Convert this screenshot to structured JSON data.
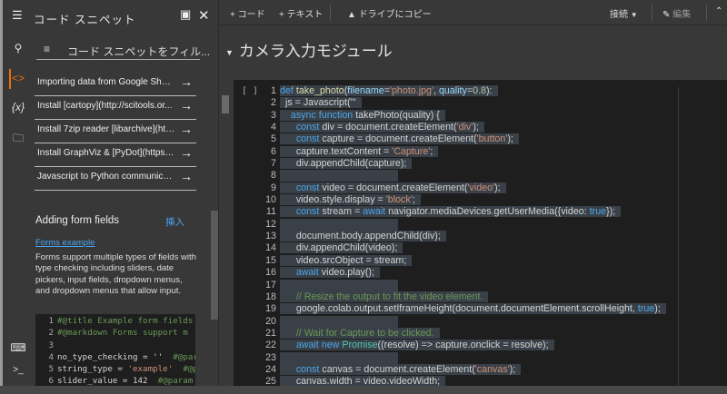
{
  "sidebar_rail": {
    "icons": [
      "menu-icon",
      "search-icon",
      "code-icon",
      "variables-icon",
      "folder-icon",
      "command-palette-icon",
      "terminal-icon"
    ],
    "variables_glyph": "{x}"
  },
  "panel": {
    "title": "コード スニペット",
    "filter_placeholder": "コード スニペットをフィル...",
    "items": [
      "Importing data from Google Sheets",
      "Install [cartopy](http://scitools.or...",
      "Install 7zip reader [libarchive](htt...",
      "Install GraphViz & [PyDot](https://...",
      "Javascript to Python communicat..."
    ],
    "section": {
      "title": "Adding form fields",
      "insert_label": "挿入",
      "link": "Forms example",
      "description": "Forms support multiple types of fields with type checking including sliders, date pickers, input fields, dropdown menus, and dropdown menus that allow input.",
      "code": [
        [
          [
            "cm",
            "#@title Example form fields"
          ]
        ],
        [
          [
            "cm",
            "#@markdown Forms support m"
          ]
        ],
        [],
        [
          [
            "p",
            "no_type_checking = ''  "
          ],
          [
            "cm",
            "#@para"
          ]
        ],
        [
          [
            "p",
            "string_type = "
          ],
          [
            "str",
            "'example'"
          ],
          [
            "p",
            "  "
          ],
          [
            "cm",
            "#@pa"
          ]
        ],
        [
          [
            "p",
            "slider_value = 142  "
          ],
          [
            "cm",
            "#@param"
          ]
        ]
      ]
    }
  },
  "toolbar": {
    "add_code": "+ コード",
    "add_text": "+ テキスト",
    "copy_drive": "ドライブにコピー",
    "connect": "接続",
    "edit": "編集"
  },
  "notebook": {
    "heading": "カメラ入力モジュール",
    "run_indicator": "[ ]",
    "code": [
      [
        [
          "kw",
          "def"
        ],
        [
          "p",
          " "
        ],
        [
          "fn",
          "take_photo"
        ],
        [
          "p",
          "("
        ],
        [
          "param",
          "filename"
        ],
        [
          "p",
          "="
        ],
        [
          "str",
          "'photo.jpg'"
        ],
        [
          "p",
          ", "
        ],
        [
          "param",
          "quality"
        ],
        [
          "p",
          "="
        ],
        [
          "num",
          "0.8"
        ],
        [
          "p",
          "):"
        ]
      ],
      [
        [
          "p",
          "  js = Javascript('''"
        ]
      ],
      [
        [
          "p",
          "    "
        ],
        [
          "kw",
          "async function"
        ],
        [
          "p",
          " takePhoto(quality) {"
        ]
      ],
      [
        [
          "p",
          "      "
        ],
        [
          "kw",
          "const"
        ],
        [
          "p",
          " div = document.createElement("
        ],
        [
          "str",
          "'div'"
        ],
        [
          "p",
          ");"
        ]
      ],
      [
        [
          "p",
          "      "
        ],
        [
          "kw",
          "const"
        ],
        [
          "p",
          " capture = document.createElement("
        ],
        [
          "str",
          "'button'"
        ],
        [
          "p",
          ");"
        ]
      ],
      [
        [
          "p",
          "      capture.textContent = "
        ],
        [
          "str",
          "'Capture'"
        ],
        [
          "p",
          ";"
        ]
      ],
      [
        [
          "p",
          "      div.appendChild(capture);"
        ]
      ],
      [],
      [
        [
          "p",
          "      "
        ],
        [
          "kw",
          "const"
        ],
        [
          "p",
          " video = document.createElement("
        ],
        [
          "str",
          "'video'"
        ],
        [
          "p",
          ");"
        ]
      ],
      [
        [
          "p",
          "      video.style.display = "
        ],
        [
          "str",
          "'block'"
        ],
        [
          "p",
          ";"
        ]
      ],
      [
        [
          "p",
          "      "
        ],
        [
          "kw",
          "const"
        ],
        [
          "p",
          " stream = "
        ],
        [
          "kw",
          "await"
        ],
        [
          "p",
          " navigator.mediaDevices.getUserMedia({video: "
        ],
        [
          "kw",
          "true"
        ],
        [
          "p",
          "});"
        ]
      ],
      [],
      [
        [
          "p",
          "      document.body.appendChild(div);"
        ]
      ],
      [
        [
          "p",
          "      div.appendChild(video);"
        ]
      ],
      [
        [
          "p",
          "      video.srcObject = stream;"
        ]
      ],
      [
        [
          "p",
          "      "
        ],
        [
          "kw",
          "await"
        ],
        [
          "p",
          " video.play();"
        ]
      ],
      [],
      [
        [
          "p",
          "      "
        ],
        [
          "cm",
          "// Resize the output to fit the video element."
        ]
      ],
      [
        [
          "p",
          "      google.colab.output.setIframeHeight(document.documentElement.scrollHeight, "
        ],
        [
          "kw",
          "true"
        ],
        [
          "p",
          ");"
        ]
      ],
      [],
      [
        [
          "p",
          "      "
        ],
        [
          "cm",
          "// Wait for Capture to be clicked."
        ]
      ],
      [
        [
          "p",
          "      "
        ],
        [
          "kw",
          "await new"
        ],
        [
          "p",
          " "
        ],
        [
          "cls",
          "Promise"
        ],
        [
          "p",
          "((resolve) => capture.onclick = resolve);"
        ]
      ],
      [],
      [
        [
          "p",
          "      "
        ],
        [
          "kw",
          "const"
        ],
        [
          "p",
          " canvas = document.createElement("
        ],
        [
          "str",
          "'canvas'"
        ],
        [
          "p",
          ");"
        ]
      ],
      [
        [
          "p",
          "      canvas.width = video.videoWidth;"
        ]
      ]
    ]
  }
}
